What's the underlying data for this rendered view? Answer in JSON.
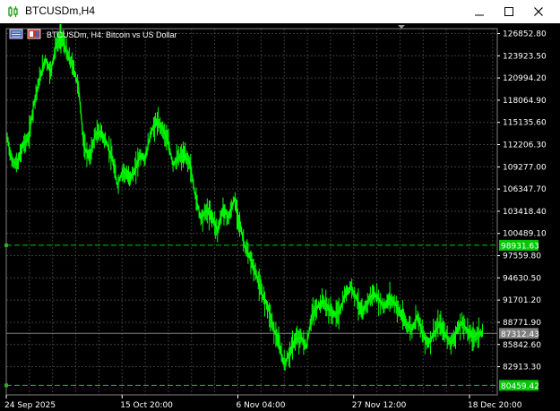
{
  "window": {
    "title": "BTCUSDm,H4",
    "minimize_icon": "minimize-icon",
    "maximize_icon": "maximize-icon",
    "close_icon": "close-icon"
  },
  "chart_header": {
    "description": "BTCUSDm, H4:  Bitcoin vs US Dollar"
  },
  "colors": {
    "background": "#000000",
    "grid": "#3c3c3c",
    "candle": "#00ff00",
    "axis_text": "#ffffff",
    "level_line": "#00c800",
    "bid_line": "#7f7f7f"
  },
  "chart_data": {
    "type": "line",
    "title": "",
    "xlabel": "",
    "ylabel": "",
    "ylim": [
      79200,
      127500
    ],
    "x_ticks": [
      "24 Sep 2025",
      "15 Oct 20:00",
      "6 Nov 04:00",
      "27 Nov 12:00",
      "18 Dec 20:00"
    ],
    "x_tick_bars": [
      0,
      125,
      250,
      375,
      500
    ],
    "y_ticks": [
      126852.8,
      123923.5,
      120994.2,
      118064.9,
      115135.6,
      112206.3,
      109277.0,
      106347.7,
      103418.4,
      100489.1,
      97559.8,
      94630.5,
      91701.2,
      88771.9,
      85842.6,
      82913.3
    ],
    "price_tags": [
      {
        "label": "98931.63",
        "value": 98931.63,
        "kind": "level"
      },
      {
        "label": "87312.43",
        "value": 87312.43,
        "kind": "bid"
      },
      {
        "label": "80459.42",
        "value": 80459.42,
        "kind": "level"
      }
    ],
    "bars_total": 530,
    "series": [
      {
        "points": [
          [
            0,
            113800
          ],
          [
            6,
            110000
          ],
          [
            12,
            109600
          ],
          [
            18,
            112200
          ],
          [
            24,
            113000
          ],
          [
            30,
            117800
          ],
          [
            36,
            120800
          ],
          [
            42,
            123500
          ],
          [
            48,
            121800
          ],
          [
            54,
            125500
          ],
          [
            60,
            126500
          ],
          [
            66,
            124000
          ],
          [
            72,
            122500
          ],
          [
            78,
            119800
          ],
          [
            84,
            111800
          ],
          [
            90,
            110500
          ],
          [
            96,
            113500
          ],
          [
            102,
            113800
          ],
          [
            108,
            112500
          ],
          [
            114,
            110500
          ],
          [
            120,
            106900
          ],
          [
            126,
            108800
          ],
          [
            132,
            107800
          ],
          [
            138,
            108500
          ],
          [
            144,
            110800
          ],
          [
            150,
            110300
          ],
          [
            156,
            113800
          ],
          [
            162,
            115200
          ],
          [
            168,
            114500
          ],
          [
            174,
            112800
          ],
          [
            180,
            109600
          ],
          [
            186,
            110500
          ],
          [
            192,
            110800
          ],
          [
            198,
            109800
          ],
          [
            204,
            105500
          ],
          [
            210,
            102500
          ],
          [
            216,
            103500
          ],
          [
            222,
            102800
          ],
          [
            228,
            100800
          ],
          [
            234,
            103800
          ],
          [
            240,
            102500
          ],
          [
            246,
            105000
          ],
          [
            252,
            101800
          ],
          [
            258,
            98500
          ],
          [
            264,
            97000
          ],
          [
            270,
            95000
          ],
          [
            276,
            92500
          ],
          [
            282,
            91000
          ],
          [
            288,
            88200
          ],
          [
            294,
            86000
          ],
          [
            300,
            83200
          ],
          [
            306,
            84800
          ],
          [
            312,
            86500
          ],
          [
            318,
            86800
          ],
          [
            324,
            85500
          ],
          [
            330,
            89800
          ],
          [
            336,
            90800
          ],
          [
            342,
            91600
          ],
          [
            348,
            90500
          ],
          [
            354,
            89800
          ],
          [
            360,
            90200
          ],
          [
            366,
            92500
          ],
          [
            372,
            93500
          ],
          [
            378,
            92000
          ],
          [
            384,
            89800
          ],
          [
            390,
            91500
          ],
          [
            396,
            92500
          ],
          [
            402,
            91800
          ],
          [
            408,
            90800
          ],
          [
            414,
            92000
          ],
          [
            420,
            91200
          ],
          [
            426,
            89800
          ],
          [
            432,
            88500
          ],
          [
            438,
            87800
          ],
          [
            444,
            89800
          ],
          [
            450,
            87000
          ],
          [
            456,
            86000
          ],
          [
            462,
            87500
          ],
          [
            468,
            88500
          ],
          [
            474,
            87200
          ],
          [
            480,
            86000
          ],
          [
            486,
            87500
          ],
          [
            492,
            88800
          ],
          [
            498,
            87600
          ],
          [
            504,
            86800
          ],
          [
            510,
            87400
          ],
          [
            514,
            87312
          ]
        ]
      }
    ]
  }
}
